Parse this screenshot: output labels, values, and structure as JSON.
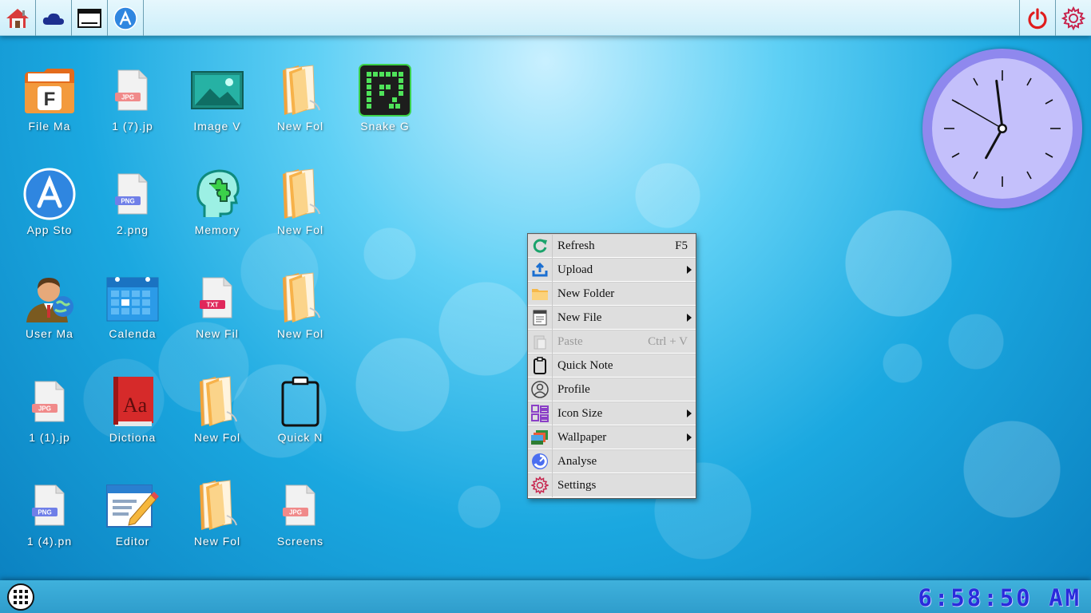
{
  "topbar": {
    "left_buttons": [
      {
        "name": "home-icon"
      },
      {
        "name": "cloud-icon"
      },
      {
        "name": "window-icon"
      },
      {
        "name": "app-store-icon"
      }
    ],
    "right_buttons": [
      {
        "name": "power-icon",
        "color": "#e01d1d"
      },
      {
        "name": "gear-icon",
        "color": "#c7254e"
      }
    ]
  },
  "desktop": {
    "icons": [
      {
        "label": "File Ma",
        "icon": "file-manager-icon"
      },
      {
        "label": "1 (7).jp",
        "icon": "jpg-file-icon",
        "badge": "JPG"
      },
      {
        "label": "Image V",
        "icon": "image-viewer-icon"
      },
      {
        "label": "New Fol",
        "icon": "folder-icon"
      },
      {
        "label": "Snake G",
        "icon": "snake-game-icon"
      },
      {
        "label": "App Sto",
        "icon": "app-store-icon"
      },
      {
        "label": "2.png",
        "icon": "png-file-icon",
        "badge": "PNG"
      },
      {
        "label": "Memory",
        "icon": "memory-game-icon"
      },
      {
        "label": "New Fol",
        "icon": "folder-icon"
      },
      {
        "label": "User Ma",
        "icon": "user-manager-icon"
      },
      {
        "label": "Calenda",
        "icon": "calendar-icon"
      },
      {
        "label": "New Fil",
        "icon": "txt-file-icon",
        "badge": "TXT"
      },
      {
        "label": "New Fol",
        "icon": "folder-icon"
      },
      {
        "label": "1 (1).jp",
        "icon": "jpg-file-icon",
        "badge": "JPG"
      },
      {
        "label": "Dictiona",
        "icon": "dictionary-icon",
        "glyph": "Aa"
      },
      {
        "label": "New Fol",
        "icon": "folder-icon"
      },
      {
        "label": "Quick N",
        "icon": "quick-note-icon"
      },
      {
        "label": "1 (4).pn",
        "icon": "png-file-icon",
        "badge": "PNG"
      },
      {
        "label": "Editor",
        "icon": "editor-icon"
      },
      {
        "label": "New Fol",
        "icon": "folder-icon"
      },
      {
        "label": "Screens",
        "icon": "jpg-file-icon",
        "badge": "JPG"
      }
    ],
    "file_manager_letter": "F"
  },
  "context_menu": {
    "items": [
      {
        "label": "Refresh",
        "shortcut": "F5",
        "icon": "refresh-icon",
        "submenu": false,
        "enabled": true
      },
      {
        "label": "Upload",
        "shortcut": "",
        "icon": "upload-icon",
        "submenu": true,
        "enabled": true
      },
      {
        "label": "New Folder",
        "shortcut": "",
        "icon": "folder-icon",
        "submenu": false,
        "enabled": true
      },
      {
        "label": "New File",
        "shortcut": "",
        "icon": "text-file-icon",
        "submenu": true,
        "enabled": true
      },
      {
        "label": "Paste",
        "shortcut": "Ctrl + V",
        "icon": "paste-icon",
        "submenu": false,
        "enabled": false
      },
      {
        "label": "Quick Note",
        "shortcut": "",
        "icon": "clipboard-icon",
        "submenu": false,
        "enabled": true
      },
      {
        "label": "Profile",
        "shortcut": "",
        "icon": "profile-icon",
        "submenu": false,
        "enabled": true
      },
      {
        "label": "Icon Size",
        "shortcut": "",
        "icon": "grid-icon",
        "submenu": true,
        "enabled": true
      },
      {
        "label": "Wallpaper",
        "shortcut": "",
        "icon": "wallpaper-icon",
        "submenu": true,
        "enabled": true
      },
      {
        "label": "Analyse",
        "shortcut": "",
        "icon": "analyse-icon",
        "submenu": false,
        "enabled": true
      },
      {
        "label": "Settings",
        "shortcut": "",
        "icon": "gear-icon",
        "submenu": false,
        "enabled": true
      }
    ]
  },
  "clock_widget": {
    "hour": 6,
    "minute": 58,
    "second": 50,
    "face_color": "#c4c0fb",
    "rim_color": "#8f88ee"
  },
  "taskbar": {
    "time_text": "6:58:50 AM",
    "start_icon": "app-grid-icon"
  },
  "colors": {
    "accent": "#2a2bdc",
    "topbar": "#d6f2fb",
    "taskbar": "#38a8d6"
  }
}
